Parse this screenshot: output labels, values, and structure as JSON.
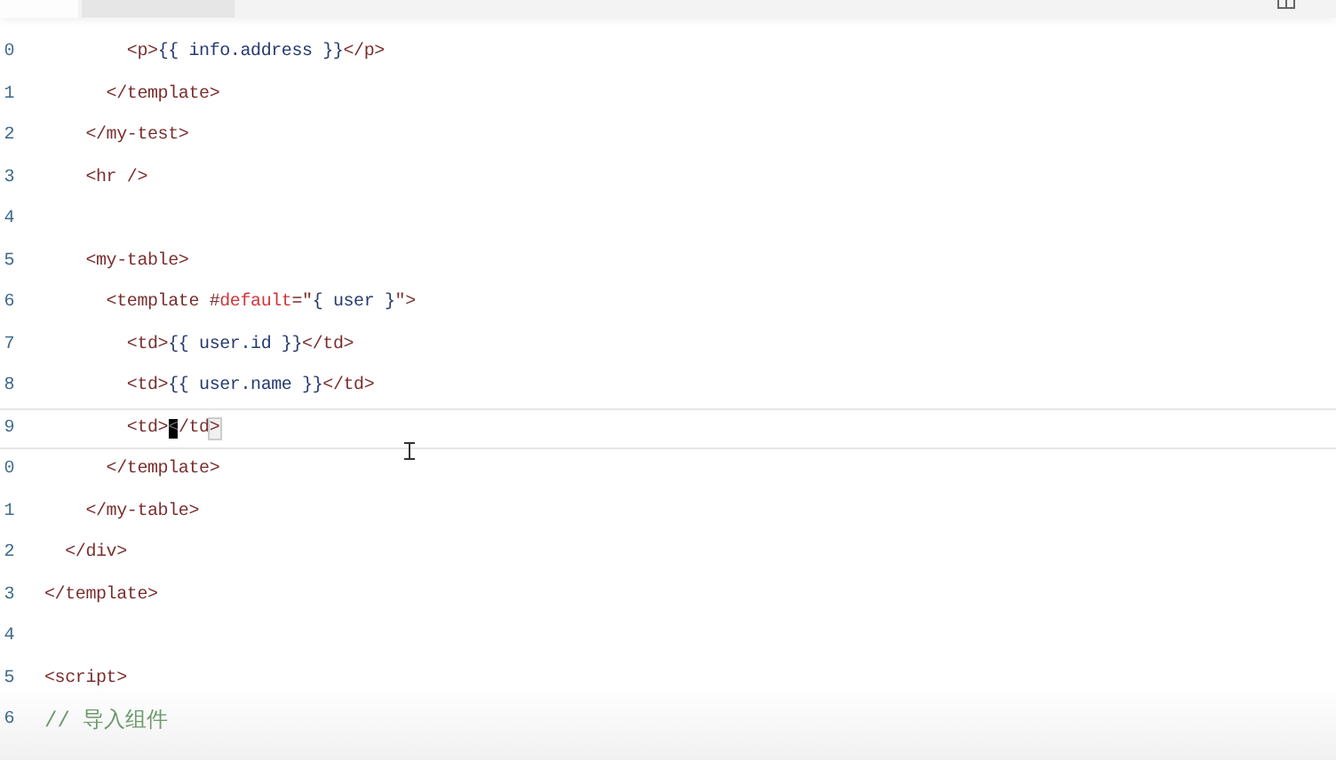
{
  "tabs": [
    {
      "selected": true
    },
    {
      "selected": false
    }
  ],
  "lines": [
    {
      "number": "0",
      "current": false,
      "tokens": [
        {
          "kind": "tag",
          "text": "        <p>"
        },
        {
          "kind": "text",
          "text": "{{ info.address }}"
        },
        {
          "kind": "tag",
          "text": "</p>"
        }
      ]
    },
    {
      "number": "1",
      "current": false,
      "tokens": [
        {
          "kind": "tag",
          "text": "      </template>"
        }
      ]
    },
    {
      "number": "2",
      "current": false,
      "tokens": [
        {
          "kind": "tag",
          "text": "    </my-test>"
        }
      ]
    },
    {
      "number": "3",
      "current": false,
      "tokens": [
        {
          "kind": "tag",
          "text": "    <hr />"
        }
      ]
    },
    {
      "number": "4",
      "current": false
    },
    {
      "number": "5",
      "current": false,
      "tokens": [
        {
          "kind": "tag",
          "text": "    <my-table>"
        }
      ]
    },
    {
      "number": "6",
      "current": false,
      "tokens": [
        {
          "kind": "tag",
          "text": "      <template #"
        },
        {
          "kind": "attr",
          "text": "default"
        },
        {
          "kind": "tag",
          "text": "=\""
        },
        {
          "kind": "text",
          "text": "{ user }"
        },
        {
          "kind": "tag",
          "text": "\">"
        }
      ]
    },
    {
      "number": "7",
      "current": false,
      "tokens": [
        {
          "kind": "tag",
          "text": "        <td>"
        },
        {
          "kind": "text",
          "text": "{{ user.id }}"
        },
        {
          "kind": "tag",
          "text": "</td>"
        }
      ]
    },
    {
      "number": "8",
      "current": false,
      "tokens": [
        {
          "kind": "tag",
          "text": "        <td>"
        },
        {
          "kind": "text",
          "text": "{{ user.name }}"
        },
        {
          "kind": "tag",
          "text": "</td>"
        }
      ]
    },
    {
      "number": "9",
      "current": true,
      "tokens": [
        {
          "kind": "tag",
          "text": "        <td>"
        },
        {
          "kind": "cursor",
          "text": "<"
        },
        {
          "kind": "tag",
          "text": "/td"
        },
        {
          "kind": "match",
          "text": ">"
        }
      ]
    },
    {
      "number": "0",
      "current": false,
      "tokens": [
        {
          "kind": "tag",
          "text": "      </template>"
        }
      ]
    },
    {
      "number": "1",
      "current": false,
      "tokens": [
        {
          "kind": "tag",
          "text": "    </my-table>"
        }
      ]
    },
    {
      "number": "2",
      "current": false,
      "tokens": [
        {
          "kind": "tag",
          "text": "  </div>"
        }
      ]
    },
    {
      "number": "3",
      "current": false,
      "tokens": [
        {
          "kind": "tag",
          "text": "</template>"
        }
      ]
    },
    {
      "number": "4",
      "current": false
    },
    {
      "number": "5",
      "current": false,
      "tokens": [
        {
          "kind": "tag",
          "text": "<script>"
        }
      ]
    },
    {
      "number": "6",
      "current": false,
      "tokens": [
        {
          "kind": "comment",
          "text": "// 导入组件"
        }
      ]
    }
  ]
}
